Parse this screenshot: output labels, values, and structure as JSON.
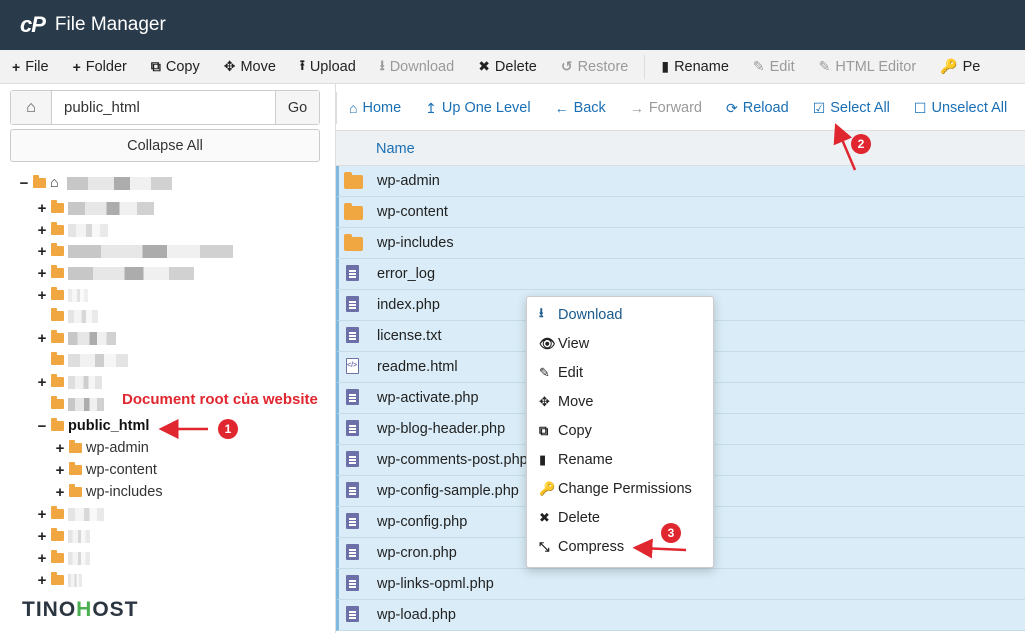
{
  "app": {
    "logo": "cP",
    "title": "File Manager"
  },
  "toolbar": [
    {
      "icon": "+",
      "label": "File",
      "disabled": false,
      "name": "new-file-button"
    },
    {
      "icon": "+",
      "label": "Folder",
      "disabled": false,
      "name": "new-folder-button"
    },
    {
      "icon": "⧉",
      "label": "Copy",
      "disabled": false,
      "name": "copy-button"
    },
    {
      "icon": "✥",
      "label": "Move",
      "disabled": false,
      "name": "move-button"
    },
    {
      "icon": "⭱",
      "label": "Upload",
      "disabled": false,
      "name": "upload-button"
    },
    {
      "icon": "⭳",
      "label": "Download",
      "disabled": true,
      "name": "download-button"
    },
    {
      "icon": "✖",
      "label": "Delete",
      "disabled": false,
      "name": "delete-button"
    },
    {
      "icon": "↺",
      "label": "Restore",
      "disabled": true,
      "name": "restore-button"
    },
    {
      "icon": "▮",
      "label": "Rename",
      "disabled": false,
      "name": "rename-button"
    },
    {
      "icon": "✎",
      "label": "Edit",
      "disabled": true,
      "name": "edit-button"
    },
    {
      "icon": "✎",
      "label": "HTML Editor",
      "disabled": true,
      "name": "html-editor-button"
    },
    {
      "icon": "🔑",
      "label": "Pe",
      "disabled": false,
      "name": "permissions-button"
    }
  ],
  "left": {
    "path_value": "public_html",
    "go_label": "Go",
    "collapse_label": "Collapse All",
    "public_html": "public_html",
    "children": [
      "wp-admin",
      "wp-content",
      "wp-includes"
    ]
  },
  "annotations": {
    "doc_root": "Document root của website",
    "badge1": "1",
    "badge2": "2",
    "badge3": "3"
  },
  "brand": {
    "part1": "TINO",
    "part2": "H",
    "part3": "OST"
  },
  "nav": [
    {
      "icon": "⌂",
      "label": "Home",
      "disabled": false,
      "name": "nav-home-button"
    },
    {
      "icon": "↥",
      "label": "Up One Level",
      "disabled": false,
      "name": "nav-up-button"
    },
    {
      "icon": "←",
      "label": "Back",
      "disabled": false,
      "name": "nav-back-button"
    },
    {
      "icon": "→",
      "label": "Forward",
      "disabled": true,
      "name": "nav-forward-button"
    },
    {
      "icon": "⟳",
      "label": "Reload",
      "disabled": false,
      "name": "nav-reload-button"
    },
    {
      "icon": "☑",
      "label": "Select All",
      "disabled": false,
      "name": "nav-select-all-button"
    },
    {
      "icon": "☐",
      "label": "Unselect All",
      "disabled": false,
      "name": "nav-unselect-all-button"
    }
  ],
  "list": {
    "header_name": "Name",
    "files": [
      {
        "name": "wp-admin",
        "type": "folder"
      },
      {
        "name": "wp-content",
        "type": "folder"
      },
      {
        "name": "wp-includes",
        "type": "folder"
      },
      {
        "name": "error_log",
        "type": "doc"
      },
      {
        "name": "index.php",
        "type": "doc"
      },
      {
        "name": "license.txt",
        "type": "doc"
      },
      {
        "name": "readme.html",
        "type": "code"
      },
      {
        "name": "wp-activate.php",
        "type": "doc"
      },
      {
        "name": "wp-blog-header.php",
        "type": "doc"
      },
      {
        "name": "wp-comments-post.php",
        "type": "doc"
      },
      {
        "name": "wp-config-sample.php",
        "type": "doc"
      },
      {
        "name": "wp-config.php",
        "type": "doc"
      },
      {
        "name": "wp-cron.php",
        "type": "doc"
      },
      {
        "name": "wp-links-opml.php",
        "type": "doc"
      },
      {
        "name": "wp-load.php",
        "type": "doc"
      }
    ]
  },
  "context_menu": [
    {
      "icon": "⭳",
      "label": "Download",
      "name": "ctx-download"
    },
    {
      "icon": "👁",
      "label": "View",
      "name": "ctx-view"
    },
    {
      "icon": "✎",
      "label": "Edit",
      "name": "ctx-edit"
    },
    {
      "icon": "✥",
      "label": "Move",
      "name": "ctx-move"
    },
    {
      "icon": "⧉",
      "label": "Copy",
      "name": "ctx-copy"
    },
    {
      "icon": "▮",
      "label": "Rename",
      "name": "ctx-rename"
    },
    {
      "icon": "🔑",
      "label": "Change Permissions",
      "name": "ctx-change-permissions"
    },
    {
      "icon": "✖",
      "label": "Delete",
      "name": "ctx-delete"
    },
    {
      "icon": "⤡",
      "label": "Compress",
      "name": "ctx-compress"
    }
  ],
  "colors": {
    "topbar": "#293a4a",
    "accent": "#1a6fb5",
    "selected_row": "#d9ecf7",
    "annotation": "#e0262f",
    "folder": "#f0a741"
  }
}
